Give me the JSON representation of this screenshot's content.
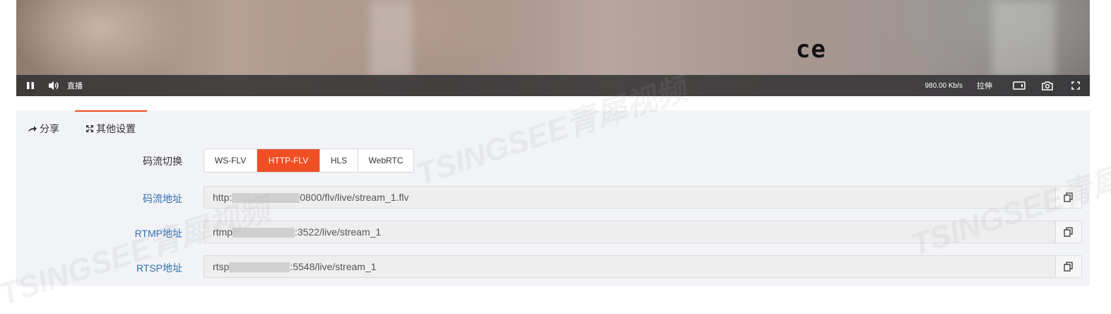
{
  "video": {
    "overlay_text": "ce",
    "controls": {
      "live_label": "直播",
      "bitrate": "980.00 Kb/s",
      "stretch_label": "拉伸"
    }
  },
  "tabs": [
    {
      "label": "分享",
      "icon": "share-icon"
    },
    {
      "label": "其他设置",
      "icon": "expand-icon",
      "active": true
    }
  ],
  "stream_switch": {
    "label": "码流切换",
    "options": [
      "WS-FLV",
      "HTTP-FLV",
      "HLS",
      "WebRTC"
    ],
    "selected": "HTTP-FLV"
  },
  "addresses": [
    {
      "label": "码流地址",
      "prefix": "http:",
      "suffix": "0800/flv/live/stream_1.flv"
    },
    {
      "label": "RTMP地址",
      "prefix": "rtmp",
      "suffix": ":3522/live/stream_1"
    },
    {
      "label": "RTSP地址",
      "prefix": "rtsp",
      "suffix": ":5548/live/stream_1"
    }
  ],
  "watermark_text": "TSINGSEE青犀视频",
  "colors": {
    "accent": "#f04e23",
    "link": "#2f6fb0",
    "panel_bg": "#f2f3f6"
  }
}
